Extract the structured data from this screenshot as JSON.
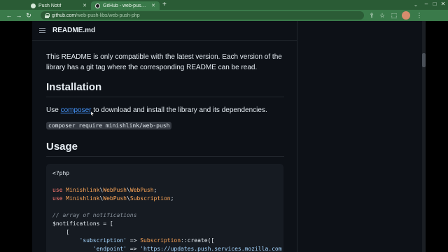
{
  "browser": {
    "tabs": [
      {
        "title": "Push Notif",
        "active": false
      },
      {
        "title": "GitHub - web-push-libs/w",
        "active": true
      }
    ],
    "address": {
      "host": "github.com",
      "path": "/web-push-libs/web-push-php"
    }
  },
  "readme": {
    "header_title": "README.md",
    "para_compat": [
      "This README is only compatible with the latest version. Each version of the",
      "library has a git tag where the corresponding README can be read."
    ],
    "installation": {
      "heading": "Installation",
      "text_before": "Use ",
      "link": "composer",
      "text_after": " to download and install the library and its dependencies.",
      "command": "composer require minishlink/web-push"
    },
    "usage": {
      "heading": "Usage"
    }
  },
  "colors": {
    "browser_frame": "#3a7a4a",
    "page_background": "#0d1117",
    "link": "#4493f8"
  },
  "icons": [
    "list-icon",
    "lock-icon",
    "back-arrow-icon",
    "forward-arrow-icon",
    "reload-icon",
    "share-icon",
    "star-icon",
    "extensions-icon",
    "profile-avatar-icon",
    "menu-dots-icon"
  ]
}
